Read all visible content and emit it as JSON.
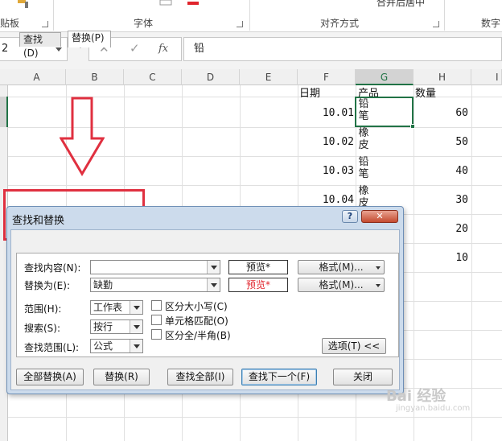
{
  "ribbon": {
    "groups": [
      {
        "label": "贴板"
      },
      {
        "label": "字体"
      },
      {
        "label": "对齐方式"
      },
      {
        "label": "数字"
      }
    ],
    "top_right_fragment": "合并后居中"
  },
  "formula_bar": {
    "name_box": "2",
    "content": "铅",
    "cancel_icon": "✕",
    "enter_icon": "✓",
    "fx_label": "fx"
  },
  "sheet": {
    "columns": [
      "A",
      "B",
      "C",
      "D",
      "E",
      "F",
      "G",
      "H",
      "I"
    ],
    "selected_column": "G",
    "headers": {
      "date": "日期",
      "product": "产品",
      "qty": "数量"
    },
    "rows": [
      {
        "date": "10.01",
        "product": "铅笔",
        "qty": "60"
      },
      {
        "date": "10.02",
        "product": "橡皮",
        "qty": "50"
      },
      {
        "date": "10.03",
        "product": "铅笔",
        "qty": "40"
      },
      {
        "date": "10.04",
        "product": "橡皮",
        "qty": "30"
      },
      {
        "date": "",
        "product": "",
        "qty": "20"
      },
      {
        "date": "",
        "product": "",
        "qty": "10"
      }
    ]
  },
  "dialog": {
    "title": "查找和替换",
    "help_btn": "?",
    "tabs": [
      {
        "label": "查找(D)"
      },
      {
        "label": "替换(P)"
      }
    ],
    "find_label": "查找内容(N):",
    "find_value": "",
    "replace_label": "替换为(E):",
    "replace_value": "缺勤",
    "preview_label": "预览*",
    "format_label": "格式(M)...",
    "scope_label": "范围(H):",
    "scope_value": "工作表",
    "search_label": "搜索(S):",
    "search_value": "按行",
    "lookin_label": "查找范围(L):",
    "lookin_value": "公式",
    "checkboxes": [
      {
        "label": "区分大小写(C)"
      },
      {
        "label": "单元格匹配(O)"
      },
      {
        "label": "区分全/半角(B)"
      }
    ],
    "options_label": "选项(T) <<",
    "buttons": {
      "replace_all": "全部替换(A)",
      "replace": "替换(R)",
      "find_all": "查找全部(I)",
      "find_next": "查找下一个(F)",
      "close": "关闭"
    },
    "colors": {
      "preview_red": "#e0242c",
      "annotation_red": "#e03040"
    }
  },
  "watermark": {
    "text": "Bai 经验",
    "sub": "jingyan.baidu.com"
  }
}
